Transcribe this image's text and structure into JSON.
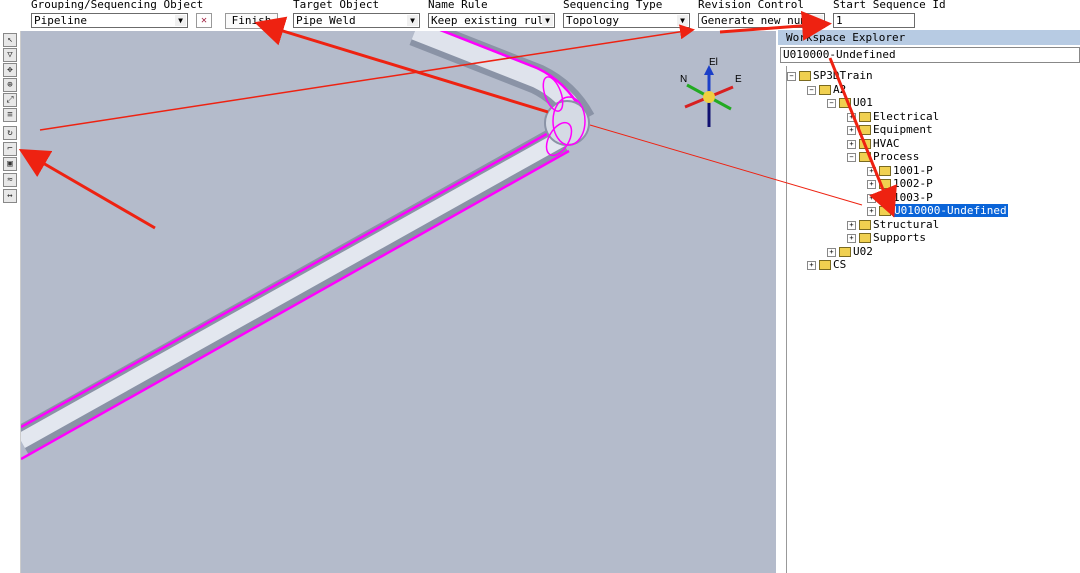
{
  "toolbar": {
    "grouping_label": "Grouping/Sequencing Object",
    "grouping_value": "Pipeline",
    "close_glyph": "✕",
    "finish_label": "Finish",
    "target_label": "Target Object",
    "target_value": "Pipe Weld",
    "name_rule_label": "Name Rule",
    "name_rule_value": "Keep existing rule",
    "seq_type_label": "Sequencing Type",
    "seq_type_value": "Topology",
    "revision_label": "Revision Control",
    "revision_value": "Generate new numbe",
    "start_seq_label": "Start Sequence Id",
    "start_seq_value": "1"
  },
  "left_tools": [
    "select-icon",
    "rotate-icon",
    "pan-icon",
    "zoom-icon",
    "fit-icon",
    "layer-icon",
    "refresh-icon",
    "route-icon",
    "area-icon",
    "measure-icon",
    "dimension-icon"
  ],
  "compass": {
    "n": "N",
    "e": "E",
    "el": "El"
  },
  "explorer": {
    "title": "Workspace Explorer",
    "path": "U010000-Undefined",
    "tree": [
      {
        "label": "SP3DTrain",
        "toggle": "−"
      },
      {
        "label": "A2",
        "toggle": "−"
      },
      {
        "label": "U01",
        "toggle": "−"
      },
      {
        "label": "Electrical",
        "toggle": "+"
      },
      {
        "label": "Equipment",
        "toggle": "+"
      },
      {
        "label": "HVAC",
        "toggle": "+"
      },
      {
        "label": "Process",
        "toggle": "−"
      },
      {
        "label": "1001-P",
        "toggle": "+"
      },
      {
        "label": "1002-P",
        "toggle": "+"
      },
      {
        "label": "1003-P",
        "toggle": "+"
      },
      {
        "label": "U010000-Undefined",
        "toggle": "+"
      },
      {
        "label": "Structural",
        "toggle": "+"
      },
      {
        "label": "Supports",
        "toggle": "+"
      },
      {
        "label": "U02",
        "toggle": "+"
      },
      {
        "label": "CS",
        "toggle": "+"
      }
    ]
  },
  "colors": {
    "viewport_bg": "#b4bbcb",
    "pipe_highlight": "#ff00ff",
    "annotation": "#ee2211",
    "selection": "#0a64d8"
  }
}
